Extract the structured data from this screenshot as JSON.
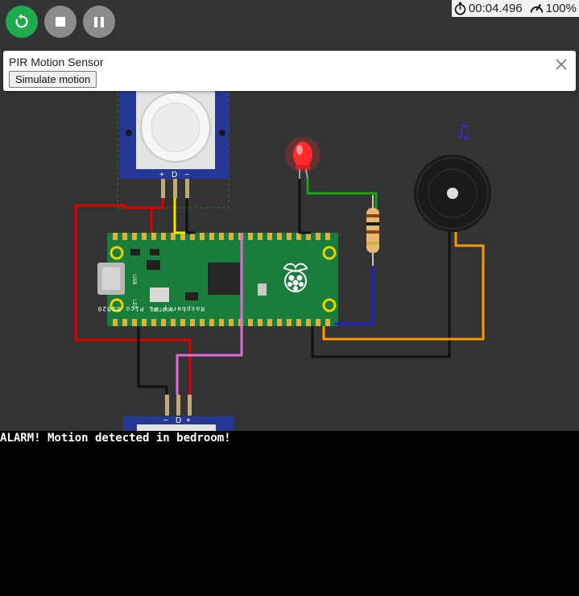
{
  "toolbar": {
    "restart_icon": "restart-icon",
    "stop_icon": "stop-icon",
    "pause_icon": "pause-icon",
    "restart_color": "#1faa4f",
    "button_color": "#8c8c8c"
  },
  "status": {
    "elapsed_time": "00:04.496",
    "speed": "100%",
    "timer_icon": "stopwatch-icon",
    "speed_icon": "speedometer-icon"
  },
  "popup": {
    "title": "PIR Motion Sensor",
    "button_label": "Simulate motion",
    "close_icon": "close-icon"
  },
  "board": {
    "name": "Raspberry Pi Pico ©2020",
    "usb_label": "USB",
    "led_label": "LED",
    "bootsel_label": "BOOTSEL",
    "color": "#1b7d3c"
  },
  "sensor_top": {
    "pins": [
      "+",
      "D",
      "−"
    ]
  },
  "sensor_bottom": {
    "pins": [
      "−",
      "D",
      "+"
    ]
  },
  "components": {
    "led_color": "#ff2a2a",
    "buzzer_icon": "music-note-icon"
  },
  "serial": {
    "line": "ALARM! Motion detected in bedroom!"
  }
}
